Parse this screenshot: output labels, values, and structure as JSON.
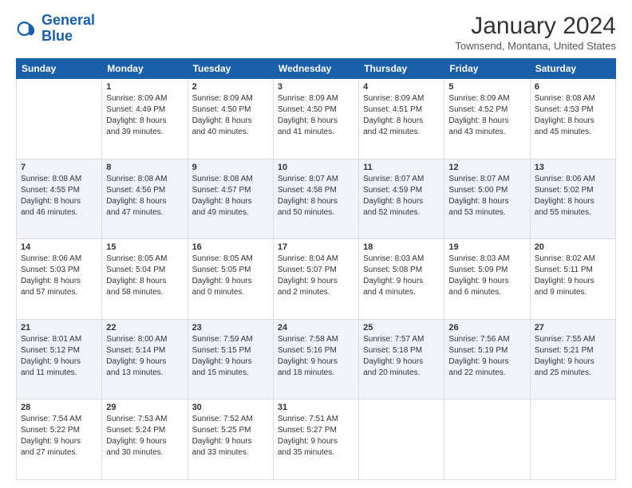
{
  "header": {
    "logo_line1": "General",
    "logo_line2": "Blue",
    "title": "January 2024",
    "subtitle": "Townsend, Montana, United States"
  },
  "weekdays": [
    "Sunday",
    "Monday",
    "Tuesday",
    "Wednesday",
    "Thursday",
    "Friday",
    "Saturday"
  ],
  "weeks": [
    [
      {
        "day": "",
        "info": ""
      },
      {
        "day": "1",
        "info": "Sunrise: 8:09 AM\nSunset: 4:49 PM\nDaylight: 8 hours\nand 39 minutes."
      },
      {
        "day": "2",
        "info": "Sunrise: 8:09 AM\nSunset: 4:50 PM\nDaylight: 8 hours\nand 40 minutes."
      },
      {
        "day": "3",
        "info": "Sunrise: 8:09 AM\nSunset: 4:50 PM\nDaylight: 8 hours\nand 41 minutes."
      },
      {
        "day": "4",
        "info": "Sunrise: 8:09 AM\nSunset: 4:51 PM\nDaylight: 8 hours\nand 42 minutes."
      },
      {
        "day": "5",
        "info": "Sunrise: 8:09 AM\nSunset: 4:52 PM\nDaylight: 8 hours\nand 43 minutes."
      },
      {
        "day": "6",
        "info": "Sunrise: 8:08 AM\nSunset: 4:53 PM\nDaylight: 8 hours\nand 45 minutes."
      }
    ],
    [
      {
        "day": "7",
        "info": "Sunrise: 8:08 AM\nSunset: 4:55 PM\nDaylight: 8 hours\nand 46 minutes."
      },
      {
        "day": "8",
        "info": "Sunrise: 8:08 AM\nSunset: 4:56 PM\nDaylight: 8 hours\nand 47 minutes."
      },
      {
        "day": "9",
        "info": "Sunrise: 8:08 AM\nSunset: 4:57 PM\nDaylight: 8 hours\nand 49 minutes."
      },
      {
        "day": "10",
        "info": "Sunrise: 8:07 AM\nSunset: 4:58 PM\nDaylight: 8 hours\nand 50 minutes."
      },
      {
        "day": "11",
        "info": "Sunrise: 8:07 AM\nSunset: 4:59 PM\nDaylight: 8 hours\nand 52 minutes."
      },
      {
        "day": "12",
        "info": "Sunrise: 8:07 AM\nSunset: 5:00 PM\nDaylight: 8 hours\nand 53 minutes."
      },
      {
        "day": "13",
        "info": "Sunrise: 8:06 AM\nSunset: 5:02 PM\nDaylight: 8 hours\nand 55 minutes."
      }
    ],
    [
      {
        "day": "14",
        "info": "Sunrise: 8:06 AM\nSunset: 5:03 PM\nDaylight: 8 hours\nand 57 minutes."
      },
      {
        "day": "15",
        "info": "Sunrise: 8:05 AM\nSunset: 5:04 PM\nDaylight: 8 hours\nand 58 minutes."
      },
      {
        "day": "16",
        "info": "Sunrise: 8:05 AM\nSunset: 5:05 PM\nDaylight: 9 hours\nand 0 minutes."
      },
      {
        "day": "17",
        "info": "Sunrise: 8:04 AM\nSunset: 5:07 PM\nDaylight: 9 hours\nand 2 minutes."
      },
      {
        "day": "18",
        "info": "Sunrise: 8:03 AM\nSunset: 5:08 PM\nDaylight: 9 hours\nand 4 minutes."
      },
      {
        "day": "19",
        "info": "Sunrise: 8:03 AM\nSunset: 5:09 PM\nDaylight: 9 hours\nand 6 minutes."
      },
      {
        "day": "20",
        "info": "Sunrise: 8:02 AM\nSunset: 5:11 PM\nDaylight: 9 hours\nand 9 minutes."
      }
    ],
    [
      {
        "day": "21",
        "info": "Sunrise: 8:01 AM\nSunset: 5:12 PM\nDaylight: 9 hours\nand 11 minutes."
      },
      {
        "day": "22",
        "info": "Sunrise: 8:00 AM\nSunset: 5:14 PM\nDaylight: 9 hours\nand 13 minutes."
      },
      {
        "day": "23",
        "info": "Sunrise: 7:59 AM\nSunset: 5:15 PM\nDaylight: 9 hours\nand 15 minutes."
      },
      {
        "day": "24",
        "info": "Sunrise: 7:58 AM\nSunset: 5:16 PM\nDaylight: 9 hours\nand 18 minutes."
      },
      {
        "day": "25",
        "info": "Sunrise: 7:57 AM\nSunset: 5:18 PM\nDaylight: 9 hours\nand 20 minutes."
      },
      {
        "day": "26",
        "info": "Sunrise: 7:56 AM\nSunset: 5:19 PM\nDaylight: 9 hours\nand 22 minutes."
      },
      {
        "day": "27",
        "info": "Sunrise: 7:55 AM\nSunset: 5:21 PM\nDaylight: 9 hours\nand 25 minutes."
      }
    ],
    [
      {
        "day": "28",
        "info": "Sunrise: 7:54 AM\nSunset: 5:22 PM\nDaylight: 9 hours\nand 27 minutes."
      },
      {
        "day": "29",
        "info": "Sunrise: 7:53 AM\nSunset: 5:24 PM\nDaylight: 9 hours\nand 30 minutes."
      },
      {
        "day": "30",
        "info": "Sunrise: 7:52 AM\nSunset: 5:25 PM\nDaylight: 9 hours\nand 33 minutes."
      },
      {
        "day": "31",
        "info": "Sunrise: 7:51 AM\nSunset: 5:27 PM\nDaylight: 9 hours\nand 35 minutes."
      },
      {
        "day": "",
        "info": ""
      },
      {
        "day": "",
        "info": ""
      },
      {
        "day": "",
        "info": ""
      }
    ]
  ]
}
